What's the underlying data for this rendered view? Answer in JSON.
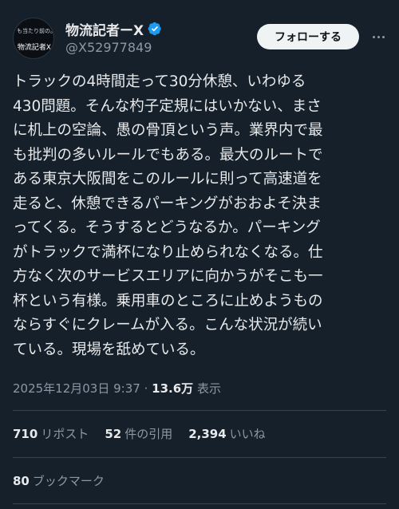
{
  "author": {
    "avatar_text_top": "も当たり前の。",
    "avatar_text_bottom": "物流記者X",
    "display_name": "物流記者ーX",
    "handle": "@X52977849",
    "verified_color": "#1d9bf0"
  },
  "actions": {
    "follow_label": "フォローする"
  },
  "tweet": {
    "lines": [
      "トラックの4時間走って30分休憩、いわゆる",
      "430問題。そんな杓子定規にはいかない、まさ",
      "に机上の空論、愚の骨頂という声。業界内で最",
      "も批判の多いルールでもある。最大のルートで",
      "ある東京大阪間をこのルールに則って高速道を",
      "走ると、休憩できるパーキングがおおよそ決ま",
      "ってくる。そうするとどうなるか。パーキング",
      "がトラックで満杯になり止められなくなる。仕",
      "方なく次のサービスエリアに向かうがそこも一",
      "杯という有様。乗用車のところに止めようもの",
      "ならすぐにクレームが入る。こんな状況が続い",
      "ている。現場を舐めている。"
    ],
    "timestamp": "2025年12月03日 9:37",
    "separator": "·",
    "views_count": "13.6万",
    "views_label": "表示"
  },
  "stats": {
    "reposts_count": "710",
    "reposts_label": "リポスト",
    "quotes_count": "52",
    "quotes_label": "件の引用",
    "likes_count": "2,394",
    "likes_label": "いいね",
    "bookmarks_count": "80",
    "bookmarks_label": "ブックマーク"
  },
  "colors": {
    "background": "#15202b",
    "text_primary": "#e7e9ea",
    "text_secondary": "#8b98a5",
    "divider": "#38444d",
    "follow_button_bg": "#eff3f4"
  }
}
